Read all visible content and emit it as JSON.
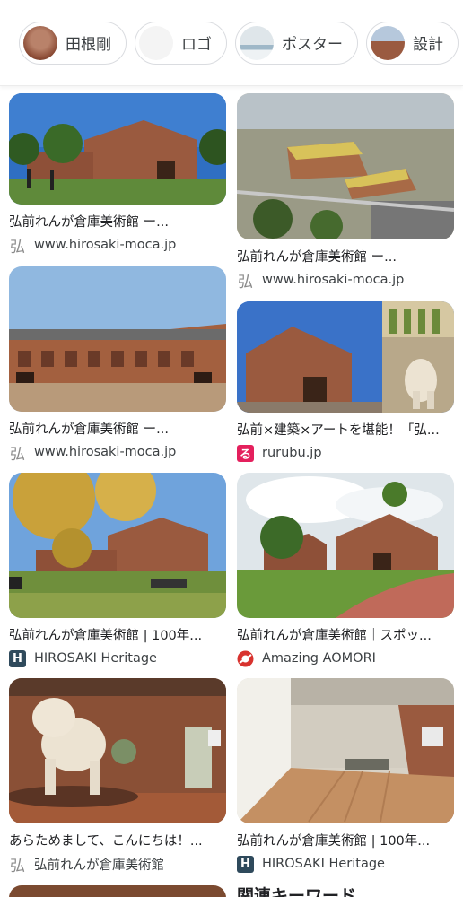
{
  "chips": [
    {
      "label": "田根剛",
      "thumb": "brick-building-thumbnail"
    },
    {
      "label": "ロゴ",
      "thumb": "logo-thumbnail"
    },
    {
      "label": "ポスター",
      "thumb": "poster-thumbnail"
    },
    {
      "label": "設計",
      "thumb": "design-thumbnail"
    }
  ],
  "results": [
    {
      "title": "弘前れんが倉庫美術館 ー...",
      "source": "www.hirosaki-moca.jp",
      "favicon": "弘"
    },
    {
      "title": "弘前れんが倉庫美術館 ー...",
      "source": "www.hirosaki-moca.jp",
      "favicon": "弘"
    },
    {
      "title": "弘前れんが倉庫美術館 ー...",
      "source": "www.hirosaki-moca.jp",
      "favicon": "弘"
    },
    {
      "title": "弘前×建築×アートを堪能！「弘...",
      "source": "rurubu.jp",
      "favicon": "る"
    },
    {
      "title": "弘前れんが倉庫美術館 | 100年...",
      "source": "HIROSAKI Heritage",
      "favicon": "H"
    },
    {
      "title": "弘前れんが倉庫美術館｜スポッ...",
      "source": "Amazing AOMORI",
      "favicon": "aomori-logo"
    },
    {
      "title": "あらためまして、こんにちは！...",
      "source": "弘前れんが倉庫美術館",
      "favicon": "弘"
    },
    {
      "title": "弘前れんが倉庫美術館 | 100年...",
      "source": "HIROSAKI Heritage",
      "favicon": "H"
    }
  ],
  "related_heading": "関連キーワード",
  "colors": {
    "brick": "#9a5a3f",
    "sky": "#8fb4da",
    "grass": "#6f9a48",
    "rurubu": "#e4205d",
    "heritage": "#2f4a5c"
  }
}
